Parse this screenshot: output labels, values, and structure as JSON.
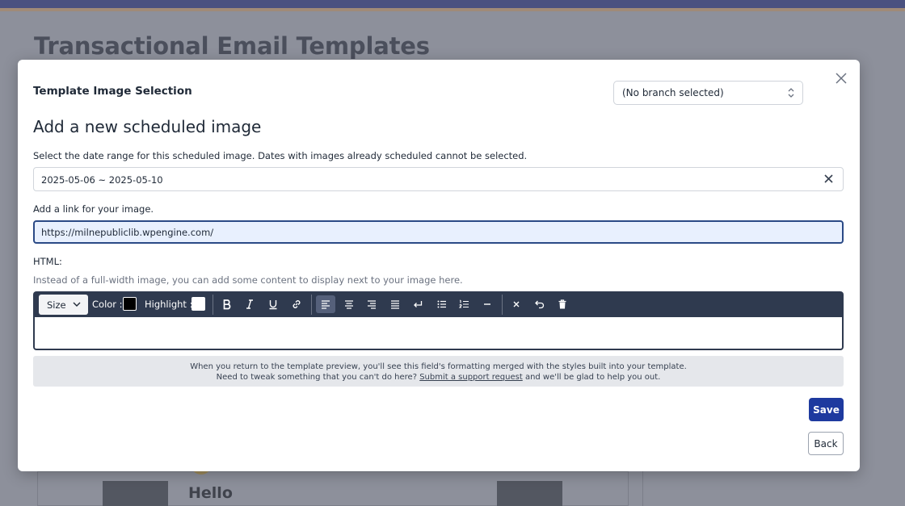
{
  "background": {
    "page_title": "Transactional Email Templates",
    "preview_heading": "Hello"
  },
  "modal": {
    "heading": "Template Image Selection",
    "branch_select": {
      "value": "(No branch selected)"
    },
    "section_title": "Add a new scheduled image",
    "date_label": "Select the date range for this scheduled image. Dates with images already scheduled cannot be selected.",
    "date_range": "2025-05-06 ~ 2025-05-10",
    "link_label": "Add a link for your image.",
    "link_value": "https://milnepubliclib.wpengine.com/",
    "html_label": "HTML:",
    "html_hint": "Instead of a full-width image, you can add some content to display next to your image here.",
    "toolbar": {
      "size_label": "Size",
      "color_label": "Color :",
      "highlight_label": "Highlight :",
      "color_value": "#000000",
      "highlight_value": "#ffffff"
    },
    "note": {
      "line1": "When you return to the template preview, you'll see this field's formatting merged with the styles built into your template.",
      "line2_before": "Need to tweak something that you can't do here?",
      "line2_link": "Submit a support request",
      "line2_after": "and we'll be glad to help you out."
    },
    "save_label": "Save",
    "back_label": "Back"
  },
  "colors": {
    "primary": "#1e3a9f",
    "toolbar": "#2f3a4f",
    "focus_border": "#2b4a86"
  }
}
